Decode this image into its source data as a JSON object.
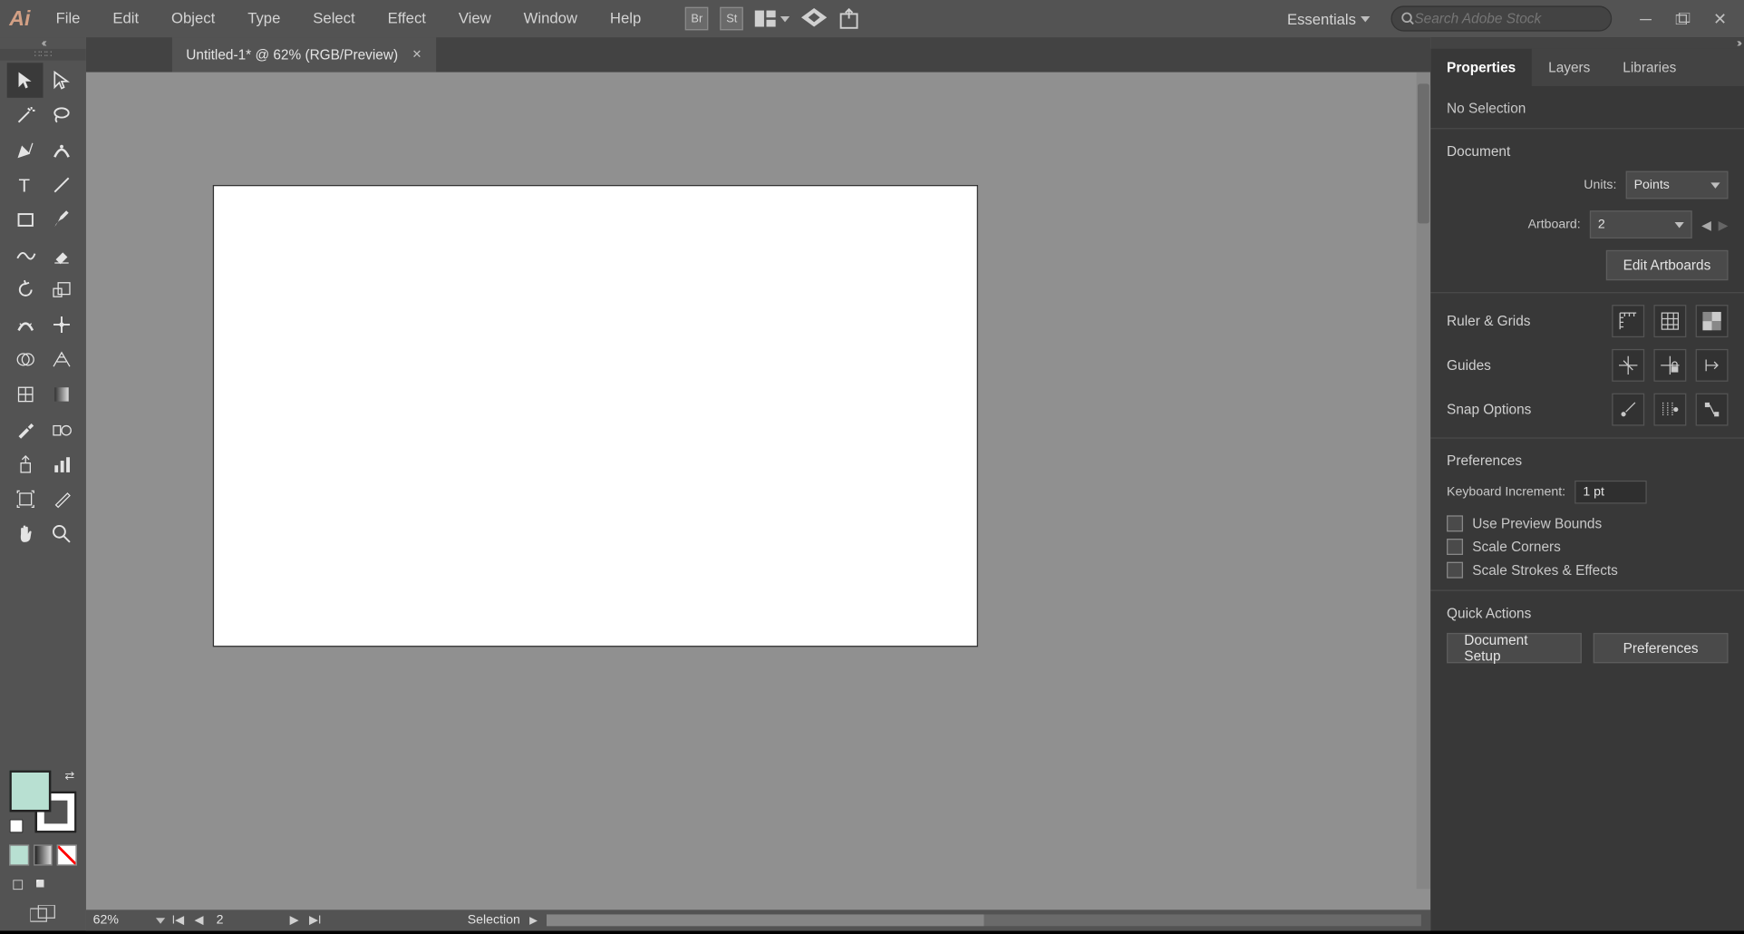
{
  "menubar": {
    "items": [
      "File",
      "Edit",
      "Object",
      "Type",
      "Select",
      "Effect",
      "View",
      "Window",
      "Help"
    ]
  },
  "workspace": "Essentials",
  "search_placeholder": "Search Adobe Stock",
  "tab": {
    "title": "Untitled-1* @ 62% (RGB/Preview)"
  },
  "statusbar": {
    "zoom": "62%",
    "artboard": "2",
    "tool": "Selection"
  },
  "rightpanel": {
    "tabs": [
      "Properties",
      "Layers",
      "Libraries"
    ],
    "active_tab": "Properties",
    "header": "No Selection",
    "sections": {
      "document": {
        "title": "Document",
        "units_label": "Units:",
        "units_value": "Points",
        "artboard_label": "Artboard:",
        "artboard_value": "2",
        "edit_artboards": "Edit Artboards"
      },
      "ruler_grids": {
        "title": "Ruler & Grids"
      },
      "guides": {
        "title": "Guides"
      },
      "snap": {
        "title": "Snap Options"
      },
      "prefs": {
        "title": "Preferences",
        "key_increment_label": "Keyboard Increment:",
        "key_increment_value": "1 pt",
        "use_preview_bounds": "Use Preview Bounds",
        "scale_corners": "Scale Corners",
        "scale_strokes": "Scale Strokes & Effects"
      },
      "quick": {
        "title": "Quick Actions",
        "doc_setup": "Document Setup",
        "preferences": "Preferences"
      }
    }
  },
  "colors": {
    "fill": "#b8e0d2"
  }
}
